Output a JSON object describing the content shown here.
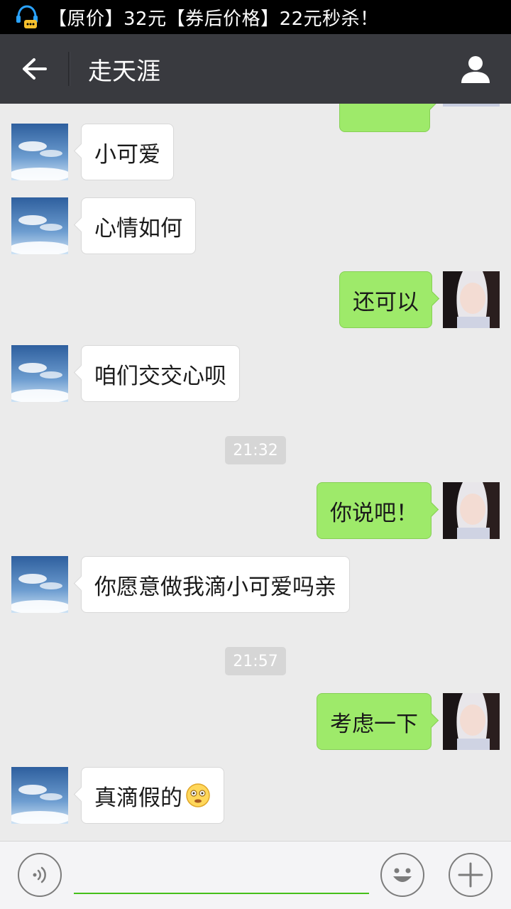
{
  "status_bar": {
    "notification_text": "【原价】32元【券后价格】22元秒杀！",
    "notification_icon": "qq-bubble-icon"
  },
  "header": {
    "title": "走天涯",
    "back_icon": "back-arrow-icon",
    "profile_icon": "person-icon"
  },
  "colors": {
    "title_bar": "#393a3f",
    "outgoing_bubble": "#9eea6a",
    "incoming_bubble": "#ffffff",
    "chat_background": "#ebebeb",
    "input_underline": "#45c01a"
  },
  "messages": [
    {
      "side": "in",
      "text": "小可爱"
    },
    {
      "side": "in",
      "text": "心情如何"
    },
    {
      "side": "out",
      "text": "还可以"
    },
    {
      "side": "in",
      "text": "咱们交交心呗"
    },
    {
      "timestamp": "21:32"
    },
    {
      "side": "out",
      "text": "你说吧！"
    },
    {
      "side": "in",
      "text": "你愿意做我滴小可爱吗亲"
    },
    {
      "timestamp": "21:57"
    },
    {
      "side": "out",
      "text": "考虑一下"
    },
    {
      "side": "in",
      "text": "真滴假的",
      "emoji": "dizzy-face-icon"
    }
  ],
  "input_bar": {
    "voice_icon": "voice-icon",
    "emoji_icon": "smiley-icon",
    "add_icon": "plus-icon",
    "value": ""
  }
}
